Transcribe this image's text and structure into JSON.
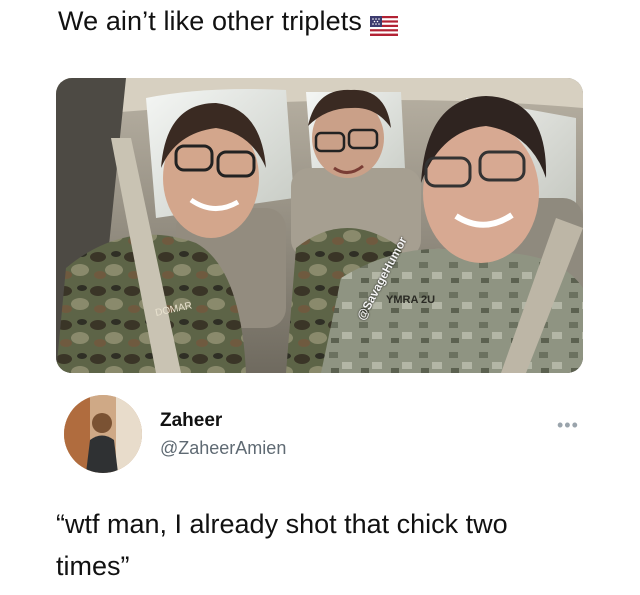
{
  "caption": {
    "text": "We ain’t like other triplets",
    "emoji_icon": "us-flag-icon"
  },
  "photo": {
    "watermark": "@SavageHumor",
    "uniform_tags": [
      "DOMAR",
      "YMRA 2U"
    ]
  },
  "tweet": {
    "avatar_icon": "user-avatar",
    "display_name": "Zaheer",
    "handle": "@ZaheerAmien",
    "more_icon": "more-dots-icon",
    "text": "“wtf man, I already shot that chick two times”"
  },
  "colors": {
    "text": "#111111",
    "handle": "#5f6a73",
    "more": "#9aa4ac"
  }
}
